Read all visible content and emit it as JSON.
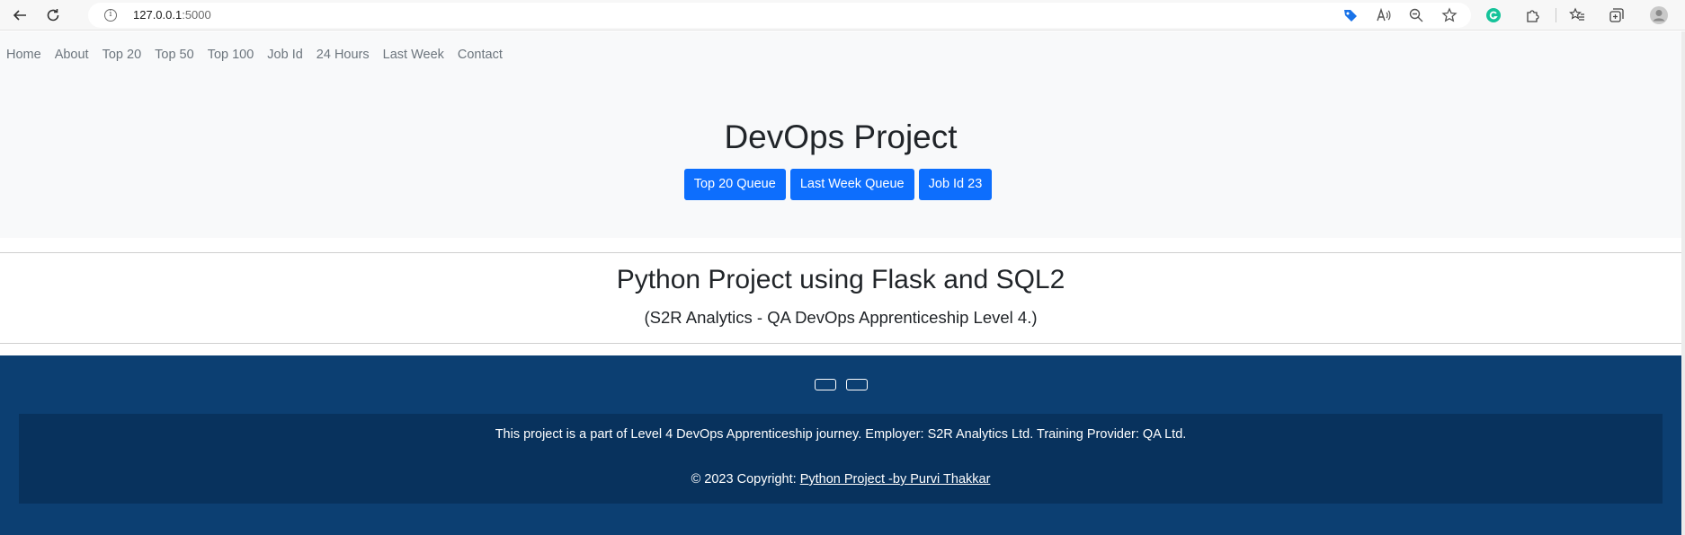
{
  "browser": {
    "url_host": "127.0.0.1",
    "url_port": ":5000",
    "info_glyph": "i"
  },
  "nav": {
    "items": [
      {
        "label": "Home"
      },
      {
        "label": "About"
      },
      {
        "label": "Top 20"
      },
      {
        "label": "Top 50"
      },
      {
        "label": "Top 100"
      },
      {
        "label": "Job Id"
      },
      {
        "label": "24 Hours"
      },
      {
        "label": "Last Week"
      },
      {
        "label": "Contact"
      }
    ]
  },
  "hero": {
    "title": "DevOps Project",
    "buttons": [
      {
        "label": "Top 20 Queue"
      },
      {
        "label": "Last Week Queue"
      },
      {
        "label": "Job Id 23"
      }
    ]
  },
  "section": {
    "title": "Python Project using Flask and SQL2",
    "caption": "(S2R Analytics - QA DevOps Apprenticeship Level 4.)"
  },
  "footer": {
    "text": "This project is a part of Level 4 DevOps Apprenticeship journey. Employer: S2R Analytics Ltd. Training Provider: QA Ltd.",
    "copyright_prefix": "© 2023 Copyright: ",
    "copyright_link": "Python Project -by Purvi Thakkar"
  },
  "colors": {
    "primary_button": "#0d6efd",
    "navbar_bg": "#f8f9fa",
    "footer_bg": "#0c3f72",
    "footer_inner_bg": "#08325d"
  }
}
